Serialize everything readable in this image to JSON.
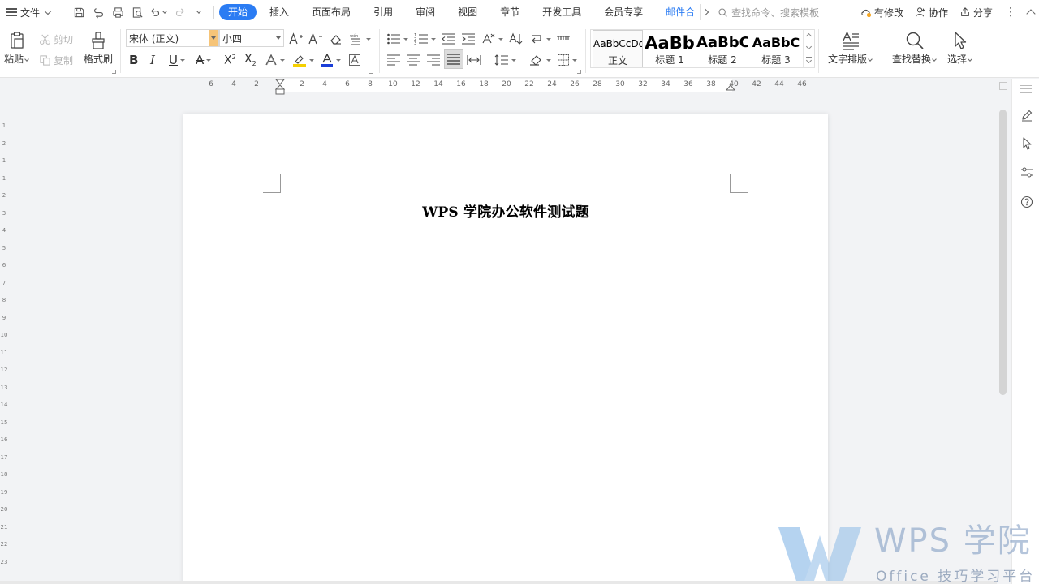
{
  "menubar": {
    "file_label": "文件",
    "tabs": [
      {
        "label": "开始",
        "active": true
      },
      {
        "label": "插入"
      },
      {
        "label": "页面布局"
      },
      {
        "label": "引用"
      },
      {
        "label": "审阅"
      },
      {
        "label": "视图"
      },
      {
        "label": "章节"
      },
      {
        "label": "开发工具"
      },
      {
        "label": "会员专享"
      },
      {
        "label": "邮件合"
      }
    ],
    "search_placeholder": "查找命令、搜索模板",
    "right_actions": {
      "modified": "有修改",
      "collab": "协作",
      "share": "分享"
    }
  },
  "ribbon": {
    "paste": "粘贴",
    "cut": "剪切",
    "copy": "复制",
    "format_painter": "格式刷",
    "font_name": "宋体 (正文)",
    "font_size": "小四",
    "styles": [
      {
        "preview": "AaBbCcDd",
        "name": "正文"
      },
      {
        "preview": "AaBb",
        "name": "标题 1"
      },
      {
        "preview": "AaBbC",
        "name": "标题 2"
      },
      {
        "preview": "AaBbC",
        "name": "标题 3"
      }
    ],
    "text_layout": "文字排版",
    "find_replace": "查找替换",
    "select": "选择"
  },
  "ruler": {
    "numbers": [
      "6",
      "4",
      "2",
      "2",
      "4",
      "6",
      "8",
      "10",
      "12",
      "14",
      "16",
      "18",
      "20",
      "22",
      "24",
      "26",
      "28",
      "30",
      "32",
      "34",
      "36",
      "38",
      "40",
      "42",
      "44",
      "46"
    ]
  },
  "vruler": {
    "numbers": [
      "1",
      "2",
      "1",
      "1",
      "2",
      "3",
      "4",
      "5",
      "6",
      "7",
      "8",
      "9",
      "10",
      "11",
      "12",
      "13",
      "14",
      "15",
      "16",
      "17",
      "18",
      "19",
      "20",
      "21",
      "22",
      "23"
    ]
  },
  "document": {
    "title": "WPS 学院办公软件测试题"
  },
  "watermark": {
    "brand": "WPS 学院",
    "tagline": "Office 技巧学习平台"
  },
  "colors": {
    "accent": "#2b7cf3",
    "highlight_yellow": "#f5d000",
    "font_color_blue": "#1b3ed8"
  }
}
